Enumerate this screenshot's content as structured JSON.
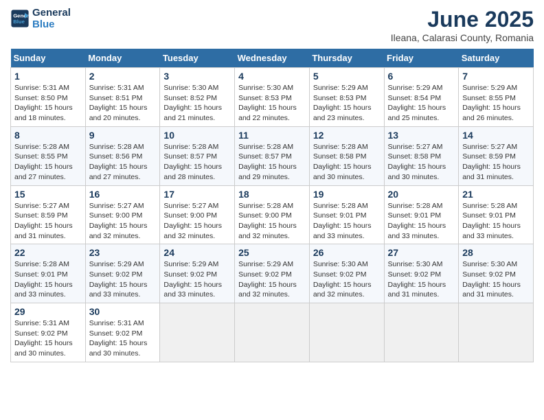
{
  "header": {
    "logo_line1": "General",
    "logo_line2": "Blue",
    "title": "June 2025",
    "subtitle": "Ileana, Calarasi County, Romania"
  },
  "calendar": {
    "headers": [
      "Sunday",
      "Monday",
      "Tuesday",
      "Wednesday",
      "Thursday",
      "Friday",
      "Saturday"
    ],
    "rows": [
      [
        {
          "day": "1",
          "info": "Sunrise: 5:31 AM\nSunset: 8:50 PM\nDaylight: 15 hours\nand 18 minutes."
        },
        {
          "day": "2",
          "info": "Sunrise: 5:31 AM\nSunset: 8:51 PM\nDaylight: 15 hours\nand 20 minutes."
        },
        {
          "day": "3",
          "info": "Sunrise: 5:30 AM\nSunset: 8:52 PM\nDaylight: 15 hours\nand 21 minutes."
        },
        {
          "day": "4",
          "info": "Sunrise: 5:30 AM\nSunset: 8:53 PM\nDaylight: 15 hours\nand 22 minutes."
        },
        {
          "day": "5",
          "info": "Sunrise: 5:29 AM\nSunset: 8:53 PM\nDaylight: 15 hours\nand 23 minutes."
        },
        {
          "day": "6",
          "info": "Sunrise: 5:29 AM\nSunset: 8:54 PM\nDaylight: 15 hours\nand 25 minutes."
        },
        {
          "day": "7",
          "info": "Sunrise: 5:29 AM\nSunset: 8:55 PM\nDaylight: 15 hours\nand 26 minutes."
        }
      ],
      [
        {
          "day": "8",
          "info": "Sunrise: 5:28 AM\nSunset: 8:55 PM\nDaylight: 15 hours\nand 27 minutes."
        },
        {
          "day": "9",
          "info": "Sunrise: 5:28 AM\nSunset: 8:56 PM\nDaylight: 15 hours\nand 27 minutes."
        },
        {
          "day": "10",
          "info": "Sunrise: 5:28 AM\nSunset: 8:57 PM\nDaylight: 15 hours\nand 28 minutes."
        },
        {
          "day": "11",
          "info": "Sunrise: 5:28 AM\nSunset: 8:57 PM\nDaylight: 15 hours\nand 29 minutes."
        },
        {
          "day": "12",
          "info": "Sunrise: 5:28 AM\nSunset: 8:58 PM\nDaylight: 15 hours\nand 30 minutes."
        },
        {
          "day": "13",
          "info": "Sunrise: 5:27 AM\nSunset: 8:58 PM\nDaylight: 15 hours\nand 30 minutes."
        },
        {
          "day": "14",
          "info": "Sunrise: 5:27 AM\nSunset: 8:59 PM\nDaylight: 15 hours\nand 31 minutes."
        }
      ],
      [
        {
          "day": "15",
          "info": "Sunrise: 5:27 AM\nSunset: 8:59 PM\nDaylight: 15 hours\nand 31 minutes."
        },
        {
          "day": "16",
          "info": "Sunrise: 5:27 AM\nSunset: 9:00 PM\nDaylight: 15 hours\nand 32 minutes."
        },
        {
          "day": "17",
          "info": "Sunrise: 5:27 AM\nSunset: 9:00 PM\nDaylight: 15 hours\nand 32 minutes."
        },
        {
          "day": "18",
          "info": "Sunrise: 5:28 AM\nSunset: 9:00 PM\nDaylight: 15 hours\nand 32 minutes."
        },
        {
          "day": "19",
          "info": "Sunrise: 5:28 AM\nSunset: 9:01 PM\nDaylight: 15 hours\nand 33 minutes."
        },
        {
          "day": "20",
          "info": "Sunrise: 5:28 AM\nSunset: 9:01 PM\nDaylight: 15 hours\nand 33 minutes."
        },
        {
          "day": "21",
          "info": "Sunrise: 5:28 AM\nSunset: 9:01 PM\nDaylight: 15 hours\nand 33 minutes."
        }
      ],
      [
        {
          "day": "22",
          "info": "Sunrise: 5:28 AM\nSunset: 9:01 PM\nDaylight: 15 hours\nand 33 minutes."
        },
        {
          "day": "23",
          "info": "Sunrise: 5:29 AM\nSunset: 9:02 PM\nDaylight: 15 hours\nand 33 minutes."
        },
        {
          "day": "24",
          "info": "Sunrise: 5:29 AM\nSunset: 9:02 PM\nDaylight: 15 hours\nand 33 minutes."
        },
        {
          "day": "25",
          "info": "Sunrise: 5:29 AM\nSunset: 9:02 PM\nDaylight: 15 hours\nand 32 minutes."
        },
        {
          "day": "26",
          "info": "Sunrise: 5:30 AM\nSunset: 9:02 PM\nDaylight: 15 hours\nand 32 minutes."
        },
        {
          "day": "27",
          "info": "Sunrise: 5:30 AM\nSunset: 9:02 PM\nDaylight: 15 hours\nand 31 minutes."
        },
        {
          "day": "28",
          "info": "Sunrise: 5:30 AM\nSunset: 9:02 PM\nDaylight: 15 hours\nand 31 minutes."
        }
      ],
      [
        {
          "day": "29",
          "info": "Sunrise: 5:31 AM\nSunset: 9:02 PM\nDaylight: 15 hours\nand 30 minutes."
        },
        {
          "day": "30",
          "info": "Sunrise: 5:31 AM\nSunset: 9:02 PM\nDaylight: 15 hours\nand 30 minutes."
        },
        {
          "day": "",
          "info": ""
        },
        {
          "day": "",
          "info": ""
        },
        {
          "day": "",
          "info": ""
        },
        {
          "day": "",
          "info": ""
        },
        {
          "day": "",
          "info": ""
        }
      ]
    ]
  }
}
